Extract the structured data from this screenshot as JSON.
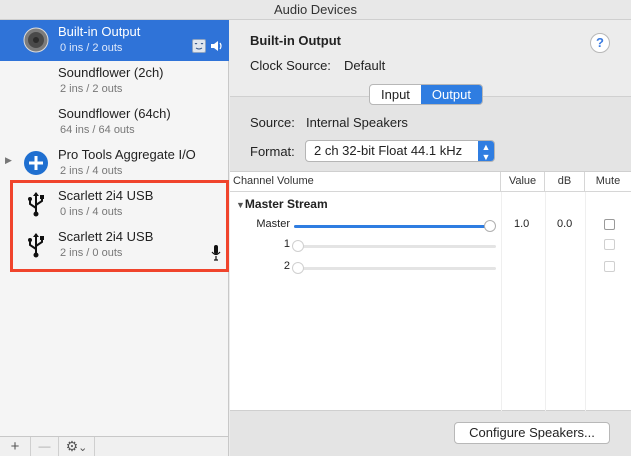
{
  "window": {
    "title": "Audio Devices"
  },
  "devices": [
    {
      "name": "Built-in Output",
      "io": "0 ins / 2 outs",
      "icon": "speaker-icon",
      "selected": true
    },
    {
      "name": "Soundflower (2ch)",
      "io": "2 ins / 2 outs",
      "icon": ""
    },
    {
      "name": "Soundflower (64ch)",
      "io": "64 ins / 64 outs",
      "icon": ""
    },
    {
      "name": "Pro Tools Aggregate I/O",
      "io": "2 ins / 4 outs",
      "icon": "aggregate-plus-icon",
      "disclosure": "▶"
    },
    {
      "name": "Scarlett 2i4 USB",
      "io": "0 ins / 4 outs",
      "icon": "usb-icon"
    },
    {
      "name": "Scarlett 2i4 USB",
      "io": "2 ins / 0 outs",
      "icon": "usb-icon"
    }
  ],
  "sidebar_toolbar": {
    "add": "+",
    "remove": "—",
    "gear": "⚙",
    "gear_menu": "⌄"
  },
  "detail": {
    "title": "Built-in Output",
    "help": "?",
    "clock_label": "Clock Source:",
    "clock_value": "Default",
    "tabs": [
      "Input",
      "Output"
    ],
    "active_tab": "Output",
    "source_label": "Source:",
    "source_value": "Internal Speakers",
    "format_label": "Format:",
    "format_value": "2 ch 32-bit Float 44.1 kHz"
  },
  "table": {
    "headers": {
      "channel": "Channel Volume",
      "value": "Value",
      "db": "dB",
      "mute": "Mute"
    },
    "section": "Master Stream",
    "section_arrow": "▼",
    "rows": [
      {
        "label": "Master",
        "value": "1.0",
        "db": "0.0",
        "level": 1.0,
        "enabled": true
      },
      {
        "label": "1",
        "value": "",
        "db": "",
        "level": 0.0,
        "enabled": false
      },
      {
        "label": "2",
        "value": "",
        "db": "",
        "level": 0.0,
        "enabled": false
      }
    ]
  },
  "configure_button": "Configure Speakers...",
  "colors": {
    "selection": "#2f73d8",
    "accent": "#2f7de1",
    "highlight_box": "#f0442c"
  }
}
